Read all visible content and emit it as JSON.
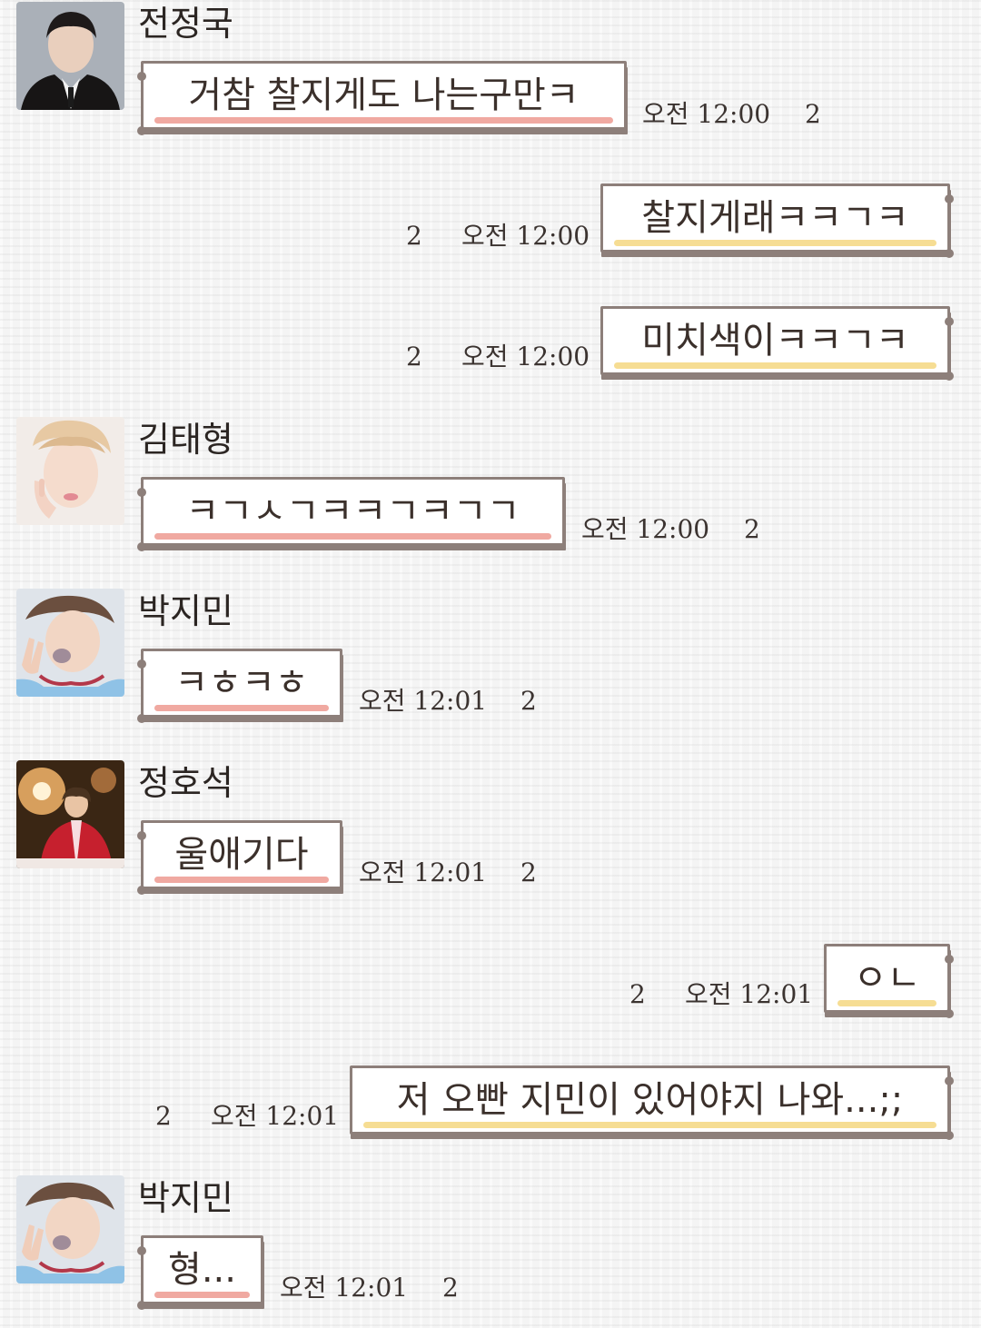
{
  "colors": {
    "bubble_border": "#8d7f7a",
    "incoming_underline": "#f0a9a1",
    "outgoing_underline": "#f6dd93",
    "background": "#f4f4f4"
  },
  "messages": [
    {
      "sender": "전정국",
      "avatar": "jungkook-avatar",
      "text": "거참 찰지게도 나는구만ㅋ",
      "time": "오전 12:00",
      "unread": "2",
      "direction": "in"
    },
    {
      "sender": "",
      "text": "찰지게래ㅋㅋㄱㅋ",
      "time": "오전 12:00",
      "unread": "2",
      "direction": "out"
    },
    {
      "sender": "",
      "text": "미치색이ㅋㅋㄱㅋ",
      "time": "오전 12:00",
      "unread": "2",
      "direction": "out"
    },
    {
      "sender": "김태형",
      "avatar": "taehyung-avatar",
      "text": "ㅋㄱㅅㄱㅋㅋㄱㅋㄱㄱ",
      "time": "오전 12:00",
      "unread": "2",
      "direction": "in"
    },
    {
      "sender": "박지민",
      "avatar": "jimin-avatar",
      "text": "ㅋㅎㅋㅎ",
      "time": "오전 12:01",
      "unread": "2",
      "direction": "in"
    },
    {
      "sender": "정호석",
      "avatar": "hoseok-avatar",
      "text": "울애기다",
      "time": "오전 12:01",
      "unread": "2",
      "direction": "in"
    },
    {
      "sender": "",
      "text": "ㅇㄴ",
      "time": "오전 12:01",
      "unread": "2",
      "direction": "out"
    },
    {
      "sender": "",
      "text": "저 오빤 지민이 있어야지 나와...;;",
      "time": "오전 12:01",
      "unread": "2",
      "direction": "out"
    },
    {
      "sender": "박지민",
      "avatar": "jimin-avatar",
      "text": "형...",
      "time": "오전 12:01",
      "unread": "2",
      "direction": "in"
    }
  ]
}
